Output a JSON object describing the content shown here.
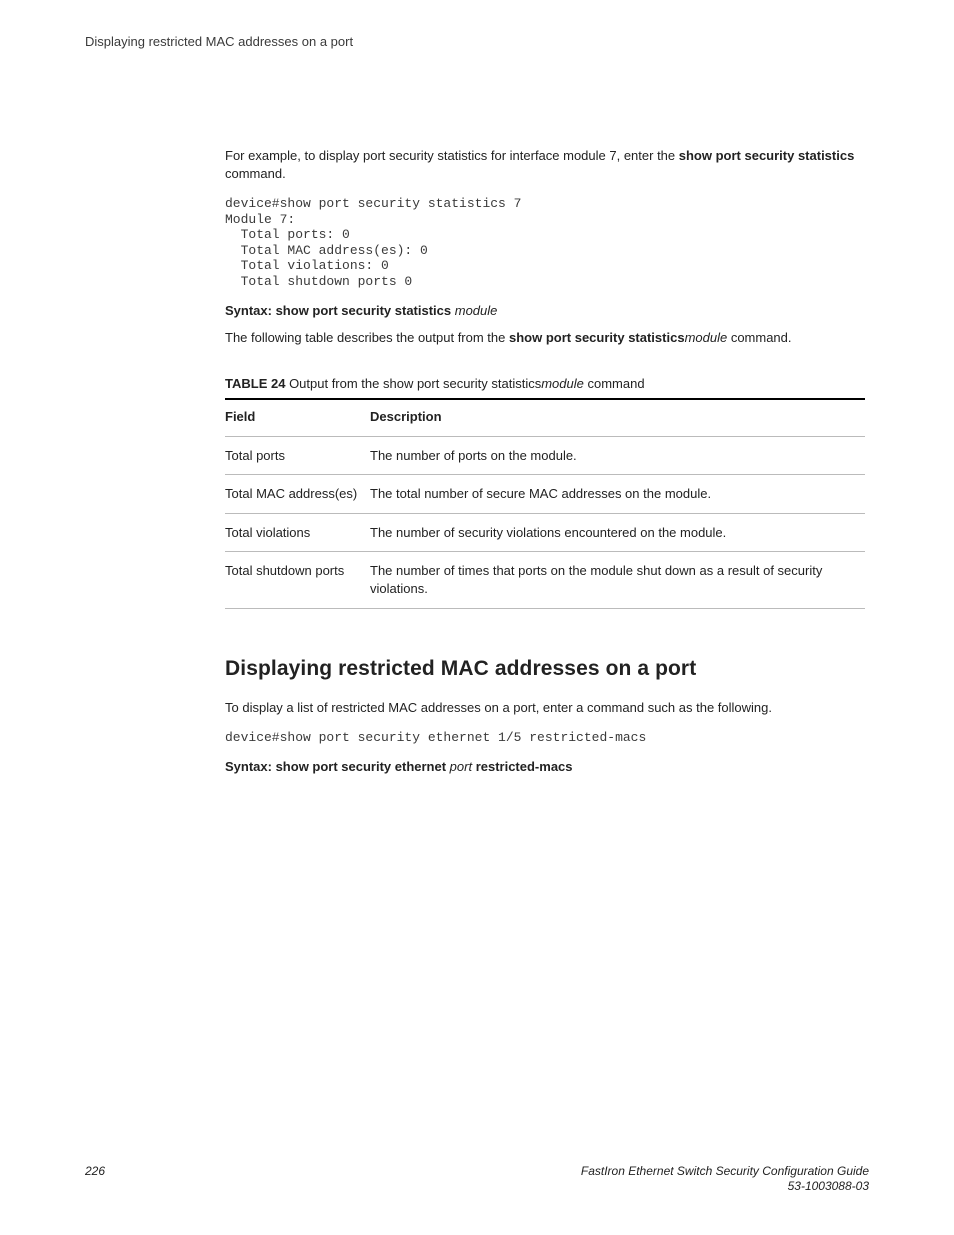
{
  "running_head": "Displaying restricted MAC addresses on a port",
  "intro": {
    "prefix": "For example, to display port security statistics for interface module 7, enter the ",
    "bold_cmd": "show port security statistics",
    "suffix": " command."
  },
  "code1": "device#show port security statistics 7\nModule 7:\n  Total ports: 0\n  Total MAC address(es): 0\n  Total violations: 0\n  Total shutdown ports 0",
  "syntax1": {
    "label": "Syntax: ",
    "bold": "show port security statistics",
    "italic": " module"
  },
  "table_intro": {
    "prefix": "The following table describes the output from the ",
    "bold": "show port security statistics",
    "italic": "module",
    "suffix": " command."
  },
  "table_caption": {
    "label": "TABLE 24 ",
    "text_before_italic": "Output from the show port security statistics",
    "italic": "module",
    "text_after_italic": " command"
  },
  "table": {
    "headers": {
      "field": "Field",
      "desc": "Description"
    },
    "rows": [
      {
        "field": "Total ports",
        "desc": "The number of ports on the module."
      },
      {
        "field": "Total MAC address(es)",
        "desc": "The total number of secure MAC addresses on the module."
      },
      {
        "field": "Total violations",
        "desc": "The number of security violations encountered on the module."
      },
      {
        "field": "Total shutdown ports",
        "desc": "The number of times that ports on the module shut down as a result of security violations."
      }
    ]
  },
  "section_heading": "Displaying restricted MAC addresses on a port",
  "section_intro": "To display a list of restricted MAC addresses on a port, enter a command such as the following.",
  "code2": "device#show port security ethernet 1/5 restricted-macs",
  "syntax2": {
    "label": "Syntax: ",
    "bold1": "show port security ethernet",
    "italic": " port ",
    "bold2": "restricted-macs"
  },
  "footer": {
    "page": "226",
    "guide": "FastIron Ethernet Switch Security Configuration Guide",
    "docnum": "53-1003088-03"
  }
}
